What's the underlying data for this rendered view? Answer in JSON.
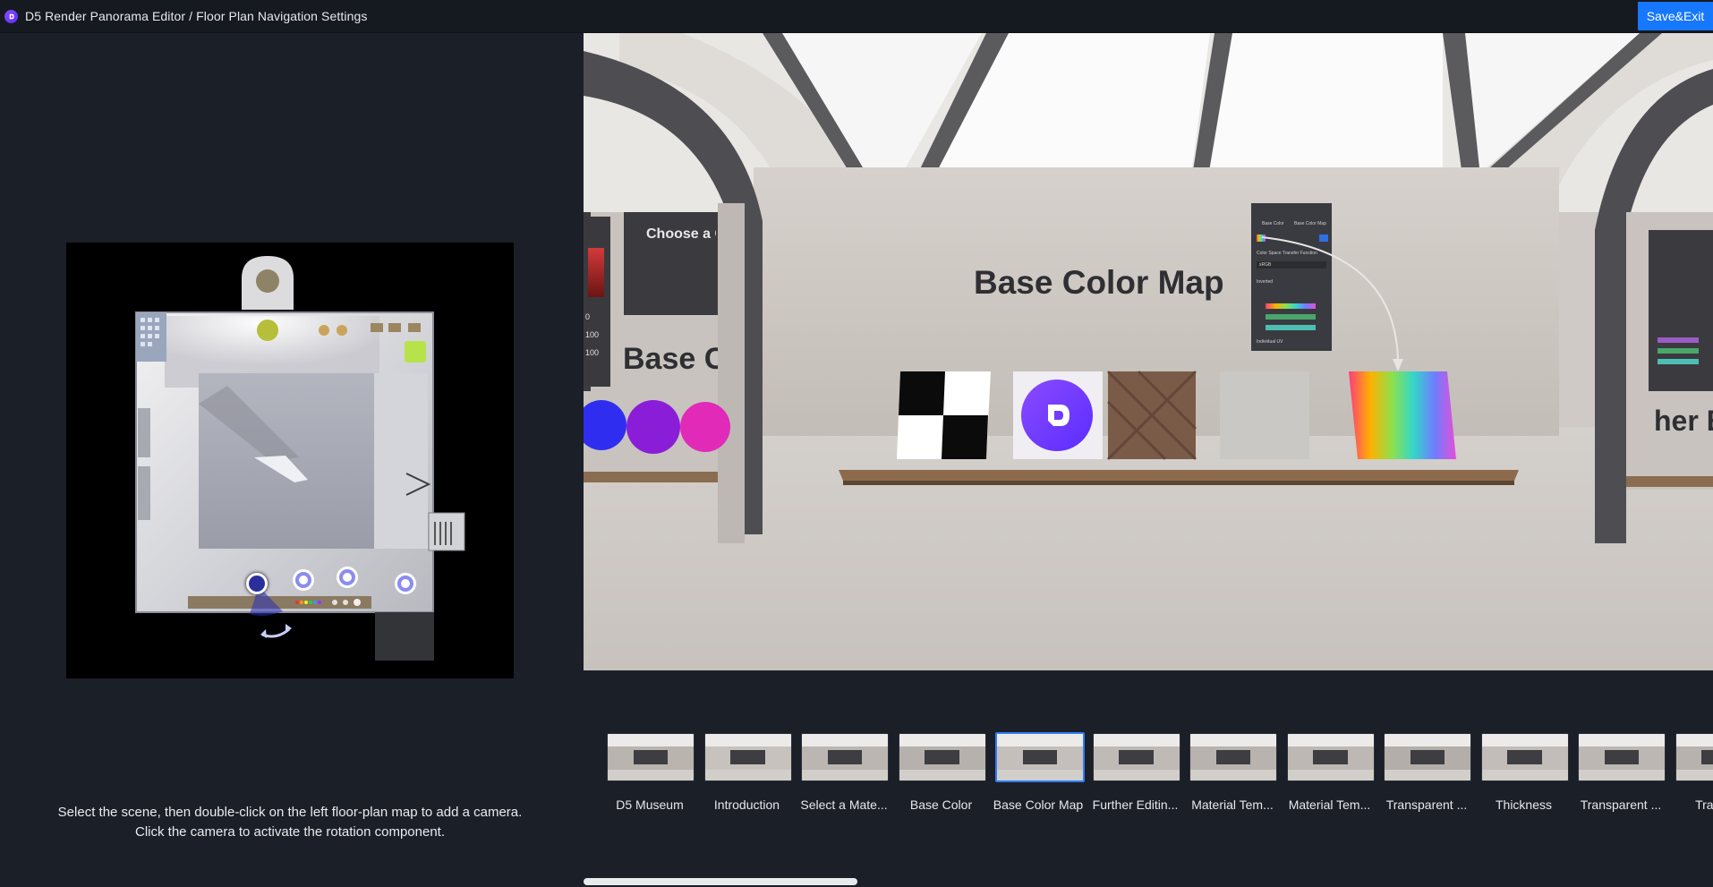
{
  "window": {
    "title": "D5 Render Panorama Editor / Floor Plan Navigation Settings",
    "save_label": "Save&Exit"
  },
  "instructions": {
    "line1": "Select the scene, then double-click on the left floor-plan map to add a camera.",
    "line2": "Click the camera to activate the rotation component."
  },
  "viewport": {
    "heading": "Base Color Map",
    "left_panel_heading": "Choose a Co",
    "left_wall_text": "Base C",
    "right_wall_text": "her E",
    "left_inputs": [
      "0",
      "100",
      "100"
    ],
    "ui_panel": {
      "tab1": "Base Color",
      "tab2": "Base Color Map",
      "transfer": "Color Space Transfer Function",
      "transfer_value": "sRGB",
      "inverted": "Inverted",
      "individual": "Individual UV"
    }
  },
  "scenes": [
    {
      "label": "D5 Museum",
      "active": false
    },
    {
      "label": "Introduction",
      "active": false
    },
    {
      "label": "Select a Mate...",
      "active": false
    },
    {
      "label": "Base Color",
      "active": false
    },
    {
      "label": "Base Color Map",
      "active": true
    },
    {
      "label": "Further Editin...",
      "active": false
    },
    {
      "label": "Material Tem...",
      "active": false
    },
    {
      "label": "Material Tem...",
      "active": false
    },
    {
      "label": "Transparent ...",
      "active": false
    },
    {
      "label": "Thickness",
      "active": false
    },
    {
      "label": "Transparent ...",
      "active": false
    },
    {
      "label": "Transpa",
      "active": false
    }
  ],
  "colors": {
    "accent": "#1677ff",
    "active_border": "#2f7cf6",
    "camera": "#7b7bf0",
    "background": "#1b1f27"
  },
  "icons": [
    "d5-logo-icon",
    "camera-marker-icon",
    "rotate-arrow-icon"
  ]
}
